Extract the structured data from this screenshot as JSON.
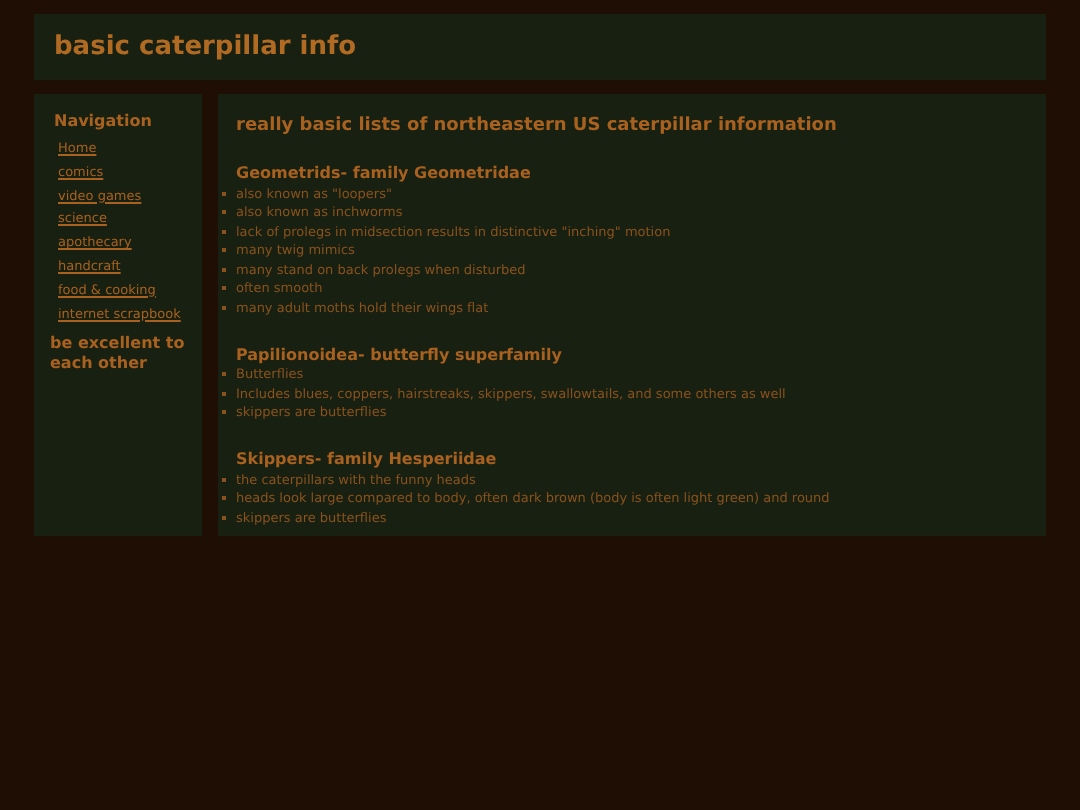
{
  "header": {
    "title": "basic caterpillar info"
  },
  "sidebar": {
    "heading": "Navigation",
    "links": [
      "Home",
      "comics",
      "video games",
      "science",
      "apothecary",
      "handcraft",
      "food & cooking",
      "internet scrapbook"
    ],
    "motto": "be excellent to each other"
  },
  "main": {
    "title": "really basic lists of northeastern US caterpillar information",
    "sections": [
      {
        "heading": "Geometrids- family Geometridae",
        "items": [
          "also known as \"loopers\"",
          "also known as inchworms",
          "lack of prolegs in midsection results in distinctive \"inching\" motion",
          "many twig mimics",
          "many stand on back prolegs when disturbed",
          "often smooth",
          "many adult moths hold their wings flat"
        ]
      },
      {
        "heading": "Papilionoidea- butterfly superfamily",
        "items": [
          "Butterflies",
          "Includes blues, coppers, hairstreaks, skippers, swallowtails, and some others as well",
          "skippers are butterflies"
        ]
      },
      {
        "heading": "Skippers- family Hesperiidae",
        "items": [
          "the caterpillars with the funny heads",
          "heads look large compared to body, often dark brown (body is often light green) and round",
          "skippers are butterflies"
        ]
      }
    ]
  }
}
